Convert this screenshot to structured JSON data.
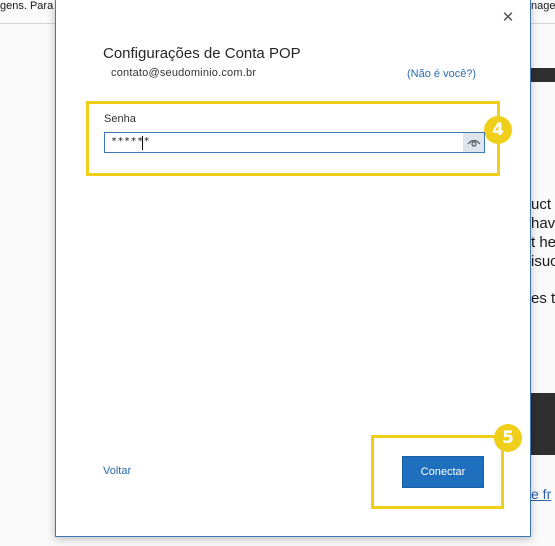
{
  "background": {
    "top_left_text": "gens. Para",
    "top_right_text": "nage",
    "right_lines": [
      "uct",
      "have",
      "t hea",
      "isuc",
      "es t"
    ],
    "bottom_link": "e fr"
  },
  "dialog": {
    "title": "Configurações de Conta POP",
    "email": "contato@seudominio.com.br",
    "not_you_link": "(Não é você?)",
    "password_label": "Senha",
    "password_value": "******",
    "back_link": "Voltar",
    "connect_button": "Conectar",
    "close_icon": "close-icon",
    "eye_icon": "eye-icon"
  },
  "highlights": {
    "step_password": "4",
    "step_connect": "5",
    "color": "#f0cf1a"
  },
  "colors": {
    "accent": "#1f6fbf",
    "link": "#2b6cb0"
  }
}
